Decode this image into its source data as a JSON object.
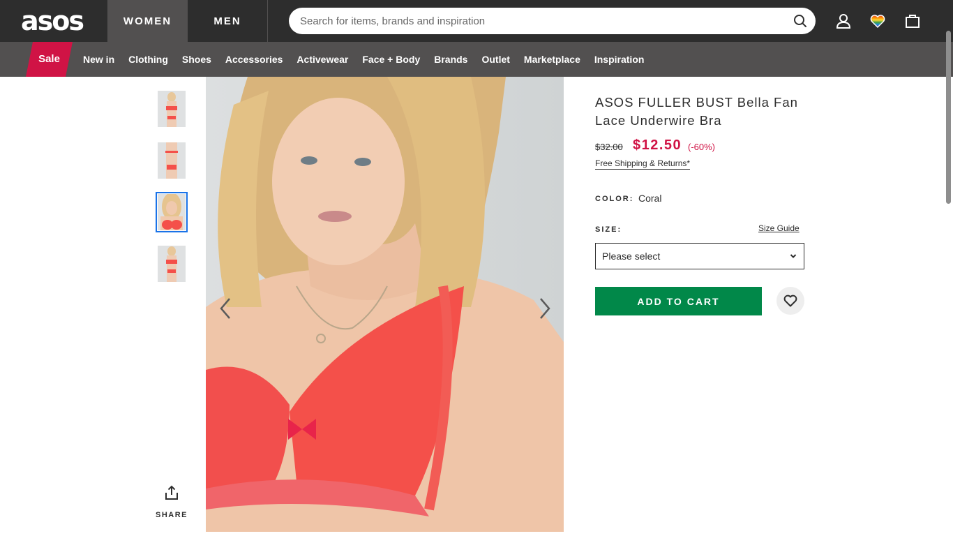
{
  "header": {
    "logo": "asos",
    "tabs": [
      {
        "label": "WOMEN",
        "active": true
      },
      {
        "label": "MEN",
        "active": false
      }
    ],
    "search": {
      "placeholder": "Search for items, brands and inspiration",
      "value": ""
    },
    "icons": [
      "search-icon",
      "account-icon",
      "wishlist-icon",
      "bag-icon"
    ]
  },
  "nav": {
    "sale": "Sale",
    "items": [
      "New in",
      "Clothing",
      "Shoes",
      "Accessories",
      "Activewear",
      "Face + Body",
      "Brands",
      "Outlet",
      "Marketplace",
      "Inspiration"
    ]
  },
  "gallery": {
    "thumbnail_count": 4,
    "selected_index": 2,
    "share_label": "SHARE"
  },
  "product": {
    "title": "ASOS FULLER BUST Bella Fan Lace Underwire Bra",
    "price_old": "$32.00",
    "price_new": "$12.50",
    "discount": "(-60%)",
    "shipping": "Free Shipping & Returns*",
    "color_label": "COLOR:",
    "color_value": "Coral",
    "size_label": "SIZE:",
    "size_guide": "Size Guide",
    "size_selected": "Please select",
    "add_to_cart": "ADD TO CART"
  },
  "colors": {
    "header_bg": "#2d2d2d",
    "nav_bg": "#525050",
    "sale": "#d01345",
    "price": "#d01345",
    "cart_button": "#018849",
    "selected_thumb_border": "#1a73e8"
  }
}
